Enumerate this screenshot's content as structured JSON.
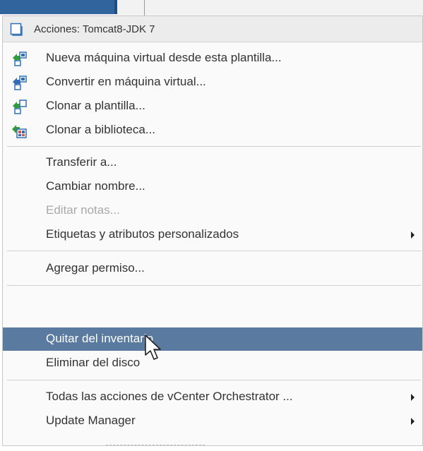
{
  "menu": {
    "header": "Acciones: Tomcat8-JDK 7",
    "items": [
      {
        "label": "Nueva máquina virtual desde esta plantilla...",
        "icon": "new-vm-from-template-icon"
      },
      {
        "label": "Convertir en máquina virtual...",
        "icon": "convert-to-vm-icon"
      },
      {
        "label": "Clonar a plantilla...",
        "icon": "clone-to-template-icon"
      },
      {
        "label": "Clonar a biblioteca...",
        "icon": "clone-to-library-icon"
      },
      {
        "label": "Transferir a..."
      },
      {
        "label": "Cambiar nombre..."
      },
      {
        "label": "Editar notas...",
        "disabled": true
      },
      {
        "label": "Etiquetas y atributos personalizados",
        "submenu": true
      },
      {
        "label": "Agregar permiso..."
      },
      {
        "label": "Quitar del inventario",
        "selected": true
      },
      {
        "label": "Eliminar del disco"
      },
      {
        "label": "Todas las acciones de vCenter Orchestrator ...",
        "submenu": true
      },
      {
        "label": "Update Manager",
        "submenu": true
      }
    ]
  },
  "colors": {
    "selected_bg": "#5b7a9f",
    "disabled_text": "#a9a9a9",
    "icon_green": "#2e9d3a",
    "icon_blue": "#2f6fb5"
  }
}
